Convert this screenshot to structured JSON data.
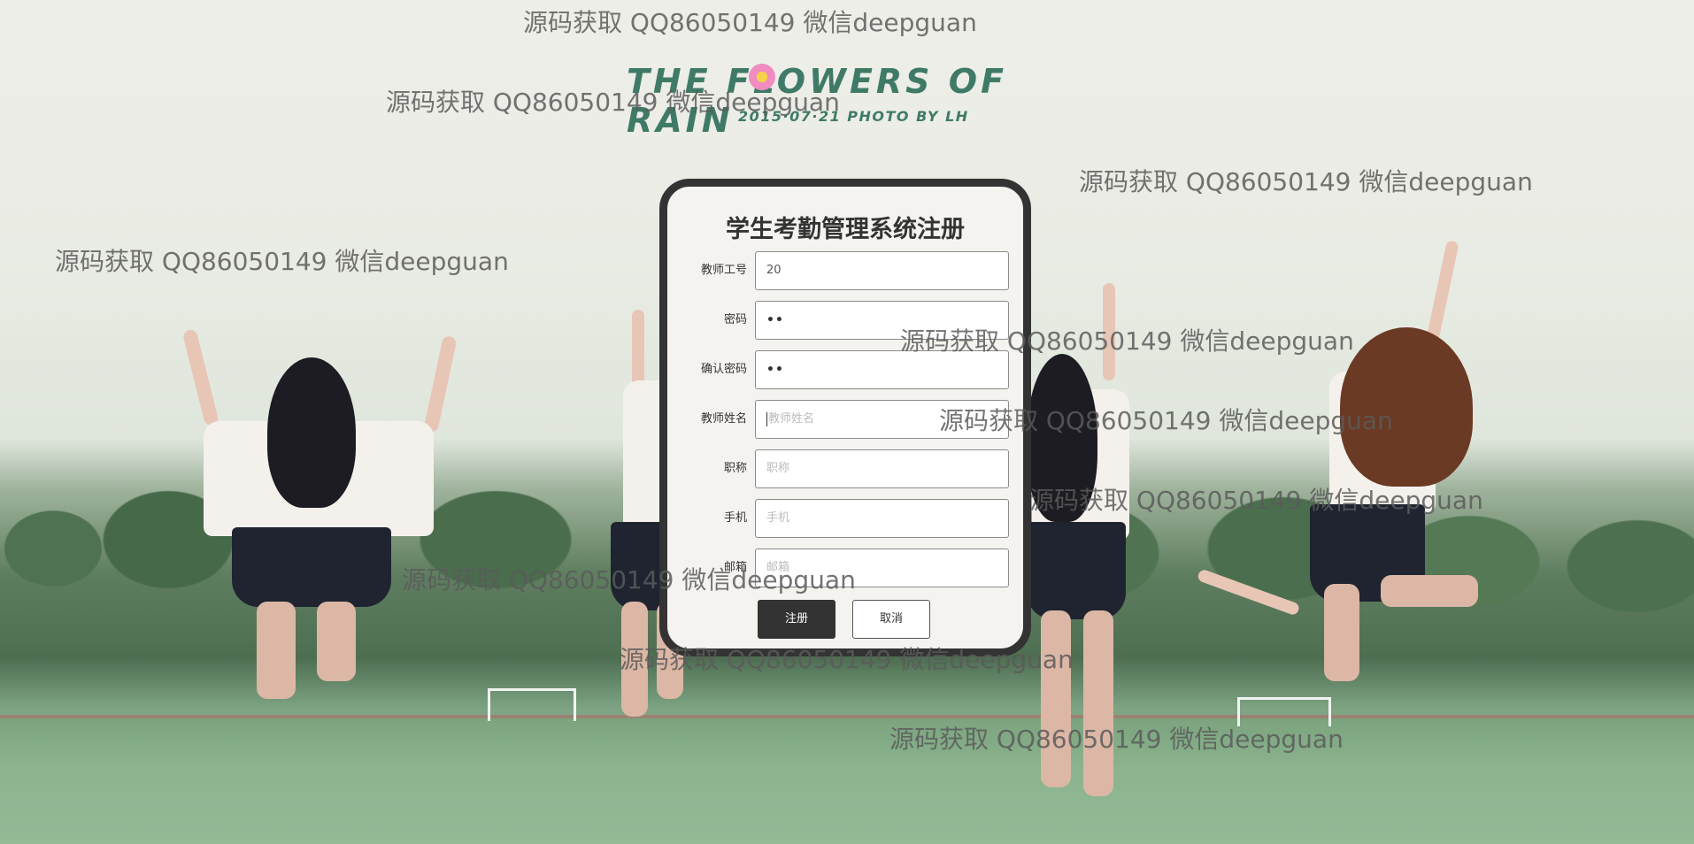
{
  "logo": {
    "title": "THE FLOWERS OF RAIN",
    "subtitle": "2015·07·21 PHOTO BY LH"
  },
  "form": {
    "title": "学生考勤管理系统注册",
    "fields": [
      {
        "label": "教师工号",
        "value": "20",
        "placeholder": ""
      },
      {
        "label": "密码",
        "value": "••",
        "placeholder": ""
      },
      {
        "label": "确认密码",
        "value": "••",
        "placeholder": ""
      },
      {
        "label": "教师姓名",
        "value": "",
        "placeholder": "教师姓名"
      },
      {
        "label": "职称",
        "value": "",
        "placeholder": "职称"
      },
      {
        "label": "手机",
        "value": "",
        "placeholder": "手机"
      },
      {
        "label": "邮箱",
        "value": "",
        "placeholder": "邮箱"
      }
    ],
    "register_label": "注册",
    "cancel_label": "取消"
  },
  "watermark": {
    "text": "源码获取 QQ86050149 微信deepguan"
  },
  "colors": {
    "panel_border": "#333333",
    "logo": "#3f7a67",
    "primary_button": "#333333"
  }
}
